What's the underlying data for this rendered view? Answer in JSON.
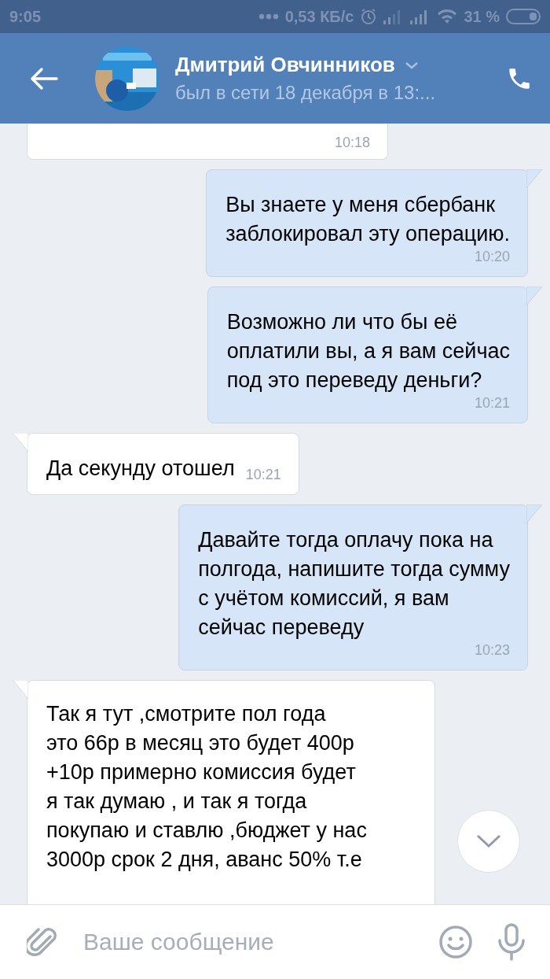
{
  "status_bar": {
    "time": "9:05",
    "speed": "0,53 КБ/с",
    "battery": "31 %"
  },
  "header": {
    "name": "Дмитрий Овчинников",
    "status": "был в сети 18 декабря в 13:..."
  },
  "messages": [
    {
      "kind": "in",
      "time": "10:18"
    },
    {
      "kind": "out",
      "text": "Вы знаете у меня сбербанк\nзаблокировал эту операцию.",
      "time": "10:20"
    },
    {
      "kind": "out",
      "text": "Возможно ли что бы её\nоплатили вы,  а я вам сейчас\nпод это переведу деньги?",
      "time": "10:21"
    },
    {
      "kind": "in",
      "text": "Да секунду отошел",
      "time": "10:21"
    },
    {
      "kind": "out",
      "text": "Давайте тогда оплачу пока на\nполгода, напишите тогда сумму\nс учётом комиссий,  я вам\nсейчас переведу",
      "time": "10:23"
    },
    {
      "kind": "in",
      "text": "Так я тут ,смотрите пол года\nэто 66р в месяц это будет 400р\n+10р примерно комиссия будет\nя так думаю , и так я тогда\nпокупаю и ставлю ,бюджет у нас\n3000р срок 2 дня, аванс 50% т.е"
    }
  ],
  "composer": {
    "placeholder": "Ваше сообщение"
  }
}
